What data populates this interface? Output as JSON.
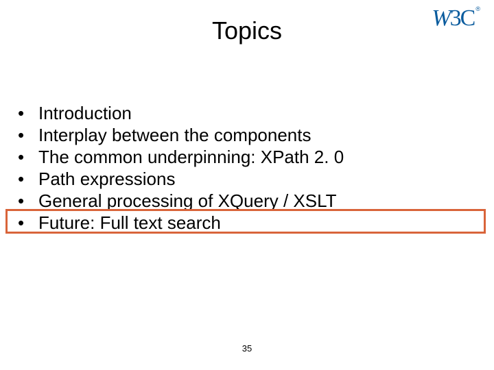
{
  "logo": {
    "text": "W3C",
    "reg": "®"
  },
  "title": "Topics",
  "bullets": [
    "Introduction",
    "Interplay between the components",
    "The common underpinning: XPath 2. 0",
    "Path expressions",
    "General processing of XQuery / XSLT",
    "Future: Full text search"
  ],
  "page_number": "35",
  "highlight_index": 5
}
